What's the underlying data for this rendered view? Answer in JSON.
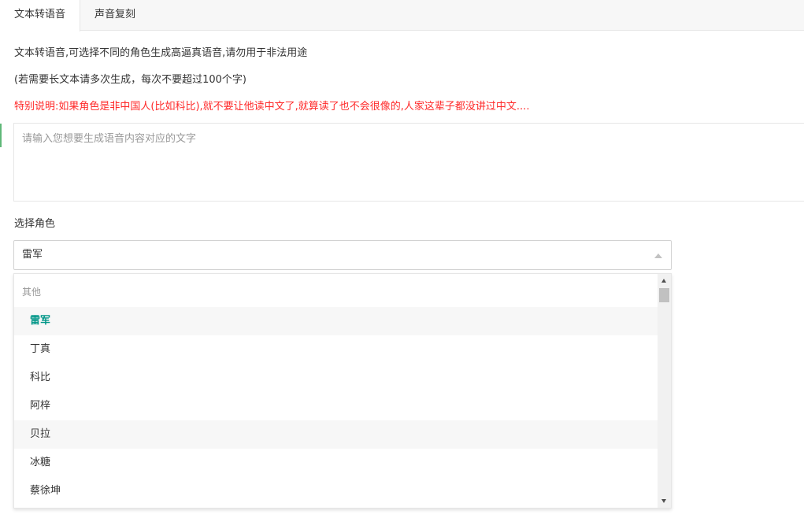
{
  "tabs": [
    {
      "label": "文本转语音",
      "active": true
    },
    {
      "label": "声音复刻",
      "active": false
    }
  ],
  "description": {
    "line1": "文本转语音,可选择不同的角色生成高逼真语音,请勿用于非法用途",
    "line2": "(若需要长文本请多次生成，每次不要超过100个字)",
    "warning": "特别说明:如果角色是非中国人(比如科比),就不要让他读中文了,就算读了也不会很像的,人家这辈子都没讲过中文...."
  },
  "text_input": {
    "value": "",
    "placeholder": "请输入您想要生成语音内容对应的文字"
  },
  "role_select": {
    "label": "选择角色",
    "selected": "雷军",
    "group_label": "其他",
    "options": [
      "雷军",
      "丁真",
      "科比",
      "阿梓",
      "贝拉",
      "冰糖",
      "蔡徐坤"
    ]
  },
  "colors": {
    "accent": "#009688",
    "warning": "#ff2a2a"
  }
}
